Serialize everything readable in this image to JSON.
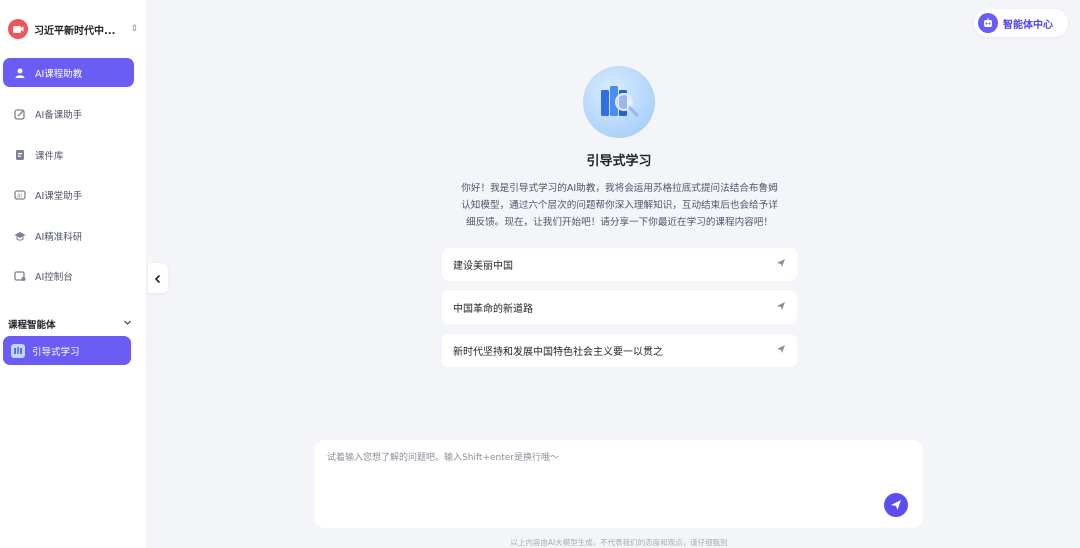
{
  "sidebar": {
    "workspace_title": "习近平新时代中...",
    "nav": [
      {
        "label": "AI课程助教",
        "icon": "user-icon",
        "active": true
      },
      {
        "label": "AI备课助手",
        "icon": "pencil-icon"
      },
      {
        "label": "课件库",
        "icon": "file-icon"
      },
      {
        "label": "AI课堂助手",
        "icon": "ai-chip-icon"
      },
      {
        "label": "AI精准科研",
        "icon": "graduation-cap-icon"
      },
      {
        "label": "AI控制台",
        "icon": "console-icon"
      }
    ],
    "section_title": "课程智能体",
    "agent": {
      "label": "引导式学习"
    }
  },
  "header": {
    "agent_center_label": "智能体中心"
  },
  "main": {
    "title": "引导式学习",
    "intro_lines": [
      "你好！我是引导式学习的AI助教，我将会运用苏格拉底式提问法结合布鲁姆",
      "认知模型，通过六个层次的问题帮你深入理解知识，互动结束后也会给予详",
      "细反馈。现在，让我们开始吧！请分享一下你最近在学习的课程内容吧！"
    ],
    "suggestions": [
      "建设美丽中国",
      "中国革命的新道路",
      "新时代坚持和发展中国特色社会主义要一以贯之"
    ],
    "input_placeholder": "试着输入您想了解的问题吧。输入Shift+enter是换行哦～",
    "disclaimer": "以上内容由AI大模型生成，不代表我们的态度和观点，谨仔细甄别"
  },
  "colors": {
    "accent": "#6b5cf5",
    "background": "#f4f5f9"
  }
}
